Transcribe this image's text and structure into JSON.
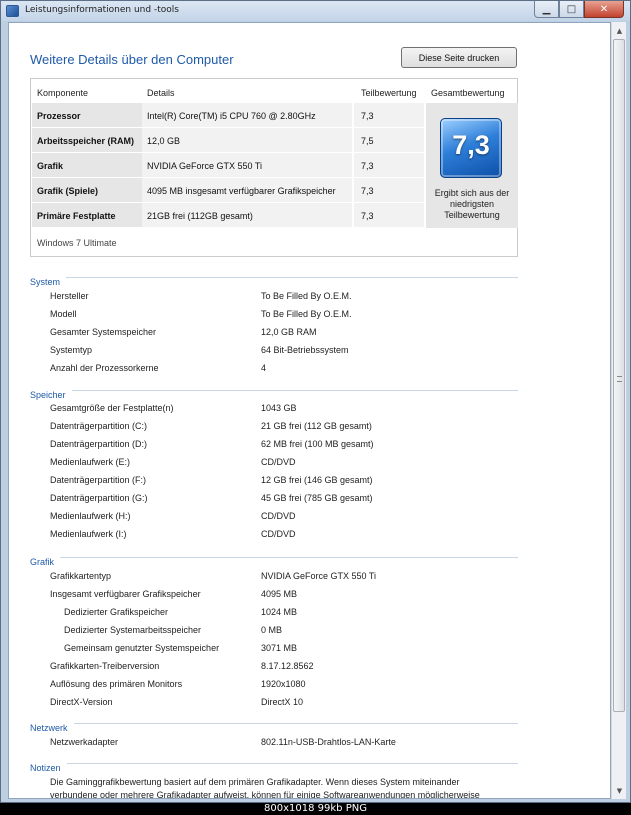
{
  "window": {
    "title": "Leistungsinformationen und -tools"
  },
  "header": {
    "title": "Weitere Details über den Computer",
    "print_button": "Diese Seite drucken"
  },
  "score_table": {
    "headers": {
      "component": "Komponente",
      "details": "Details",
      "subscore": "Teilbewertung",
      "total": "Gesamtbewertung"
    },
    "rows": [
      {
        "component": "Prozessor",
        "details": "Intel(R) Core(TM) i5 CPU 760 @ 2.80GHz",
        "subscore": "7,3"
      },
      {
        "component": "Arbeitsspeicher (RAM)",
        "details": "12,0 GB",
        "subscore": "7,5"
      },
      {
        "component": "Grafik",
        "details": "NVIDIA GeForce GTX 550 Ti",
        "subscore": "7,3"
      },
      {
        "component": "Grafik (Spiele)",
        "details": "4095 MB insgesamt verfügbarer Grafikspeicher",
        "subscore": "7,3"
      },
      {
        "component": "Primäre Festplatte",
        "details": "21GB frei (112GB gesamt)",
        "subscore": "7,3"
      }
    ],
    "total_score": "7,3",
    "total_note": "Ergibt sich aus der niedrigsten Teilbewertung",
    "edition": "Windows 7 Ultimate"
  },
  "sections": {
    "system": {
      "title": "System",
      "items": [
        {
          "key": "Hersteller",
          "value": "To Be Filled By O.E.M."
        },
        {
          "key": "Modell",
          "value": "To Be Filled By O.E.M."
        },
        {
          "key": "Gesamter Systemspeicher",
          "value": "12,0 GB RAM"
        },
        {
          "key": "Systemtyp",
          "value": "64 Bit-Betriebssystem"
        },
        {
          "key": "Anzahl der Prozessorkerne",
          "value": "4"
        }
      ]
    },
    "storage": {
      "title": "Speicher",
      "items": [
        {
          "key": "Gesamtgröße der Festplatte(n)",
          "value": "1043 GB"
        },
        {
          "key": "Datenträgerpartition (C:)",
          "value": "21 GB frei (112 GB gesamt)"
        },
        {
          "key": "Datenträgerpartition (D:)",
          "value": "62 MB frei (100 MB gesamt)"
        },
        {
          "key": "Medienlaufwerk (E:)",
          "value": "CD/DVD"
        },
        {
          "key": "Datenträgerpartition (F:)",
          "value": "12 GB frei (146 GB gesamt)"
        },
        {
          "key": "Datenträgerpartition (G:)",
          "value": "45 GB frei (785 GB gesamt)"
        },
        {
          "key": "Medienlaufwerk (H:)",
          "value": "CD/DVD"
        },
        {
          "key": "Medienlaufwerk (I:)",
          "value": "CD/DVD"
        }
      ]
    },
    "graphics": {
      "title": "Grafik",
      "items": [
        {
          "key": "Grafikkartentyp",
          "value": "NVIDIA GeForce GTX 550 Ti"
        },
        {
          "key": "Insgesamt verfügbarer Grafikspeicher",
          "value": "4095 MB"
        },
        {
          "key": "Dedizierter Grafikspeicher",
          "value": "1024 MB"
        },
        {
          "key": "Dedizierter Systemarbeitsspeicher",
          "value": "0 MB"
        },
        {
          "key": "Gemeinsam genutzter Systemspeicher",
          "value": "3071 MB"
        },
        {
          "key": "Grafikkarten-Treiberversion",
          "value": "8.17.12.8562"
        },
        {
          "key": "Auflösung des primären Monitors",
          "value": "1920x1080"
        },
        {
          "key": "DirectX-Version",
          "value": "DirectX 10"
        }
      ]
    },
    "network": {
      "title": "Netzwerk",
      "items": [
        {
          "key": "Netzwerkadapter",
          "value": "802.11n-USB-Drahtlos-LAN-Karte"
        }
      ]
    },
    "notes": {
      "title": "Notizen",
      "text_line1": "Die Gaminggrafikbewertung basiert auf dem primären Grafikadapter. Wenn dieses System miteinander",
      "text_line2": "verbundene oder mehrere Grafikadapter aufweist, können für einige Softwareanwendungen möglicherweise"
    }
  },
  "statusbar": {
    "text": "800x1018 99kb PNG"
  }
}
